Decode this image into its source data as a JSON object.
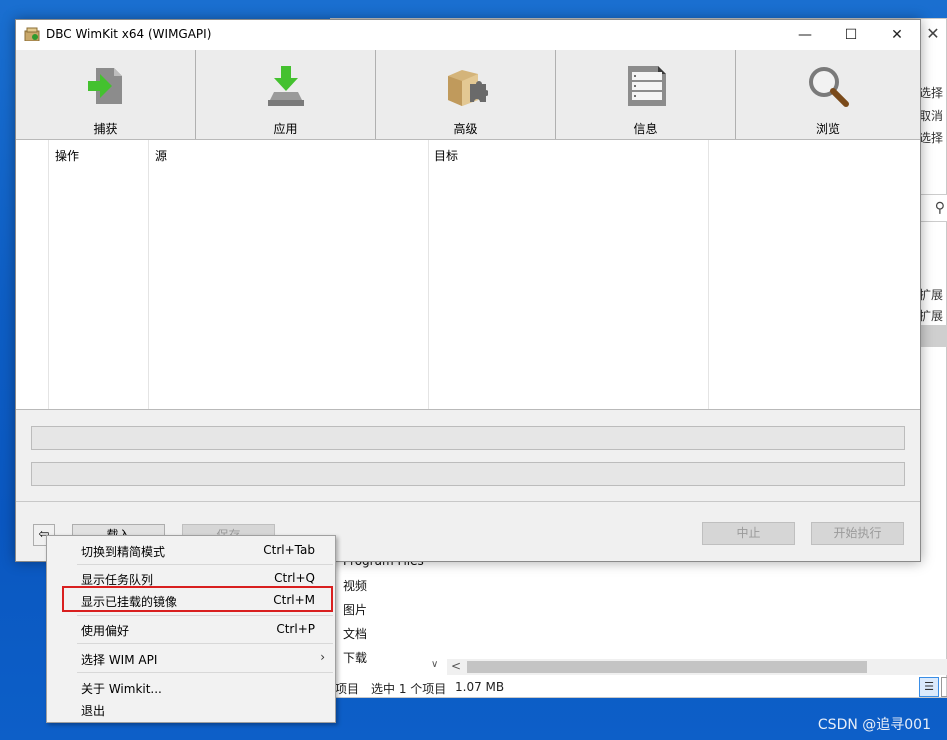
{
  "window": {
    "title": "DBC WimKit x64 (WIMGAPI)",
    "minimize_glyph": "—",
    "maximize_glyph": "☐",
    "close_glyph": "✕"
  },
  "toolbar": {
    "items": [
      {
        "label": "捕获",
        "icon": "capture-icon"
      },
      {
        "label": "应用",
        "icon": "apply-icon"
      },
      {
        "label": "高级",
        "icon": "advanced-icon"
      },
      {
        "label": "信息",
        "icon": "info-icon"
      },
      {
        "label": "浏览",
        "icon": "browse-icon"
      }
    ]
  },
  "task_list": {
    "columns": [
      "操作",
      "源",
      "目标"
    ]
  },
  "buttons": {
    "back_glyph": "⇦",
    "load": "载入",
    "save": "保存",
    "stop": "中止",
    "start": "开始执行"
  },
  "context_menu": {
    "items": [
      {
        "label": "切换到精简模式",
        "shortcut": "Ctrl+Tab"
      },
      {
        "label": "显示任务队列",
        "shortcut": "Ctrl+Q"
      },
      {
        "label": "显示已挂载的镜像",
        "shortcut": "Ctrl+M"
      },
      {
        "label": "使用偏好",
        "shortcut": "Ctrl+P"
      },
      {
        "label": "选择 WIM API",
        "shortcut": "",
        "submenu_arrow": "›"
      },
      {
        "label": "关于 Wimkit...",
        "shortcut": ""
      },
      {
        "label": "退出",
        "shortcut": ""
      }
    ],
    "highlight_color": "#d91f1f"
  },
  "background_explorer": {
    "close_glyph": "✕",
    "right_labels": [
      "选择",
      "取消",
      "选择",
      "扩展",
      "扩展"
    ],
    "search_icon": "search-icon",
    "folders": [
      "Program Files",
      "视频",
      "图片",
      "文档",
      "下载"
    ],
    "status": {
      "items_tail": "项目",
      "selected": "选中 1 个项目",
      "size": "1.07 MB"
    },
    "scroll_down_glyph": "∨",
    "scroll_left_glyph": "<"
  },
  "watermark": "CSDN @追寻001"
}
